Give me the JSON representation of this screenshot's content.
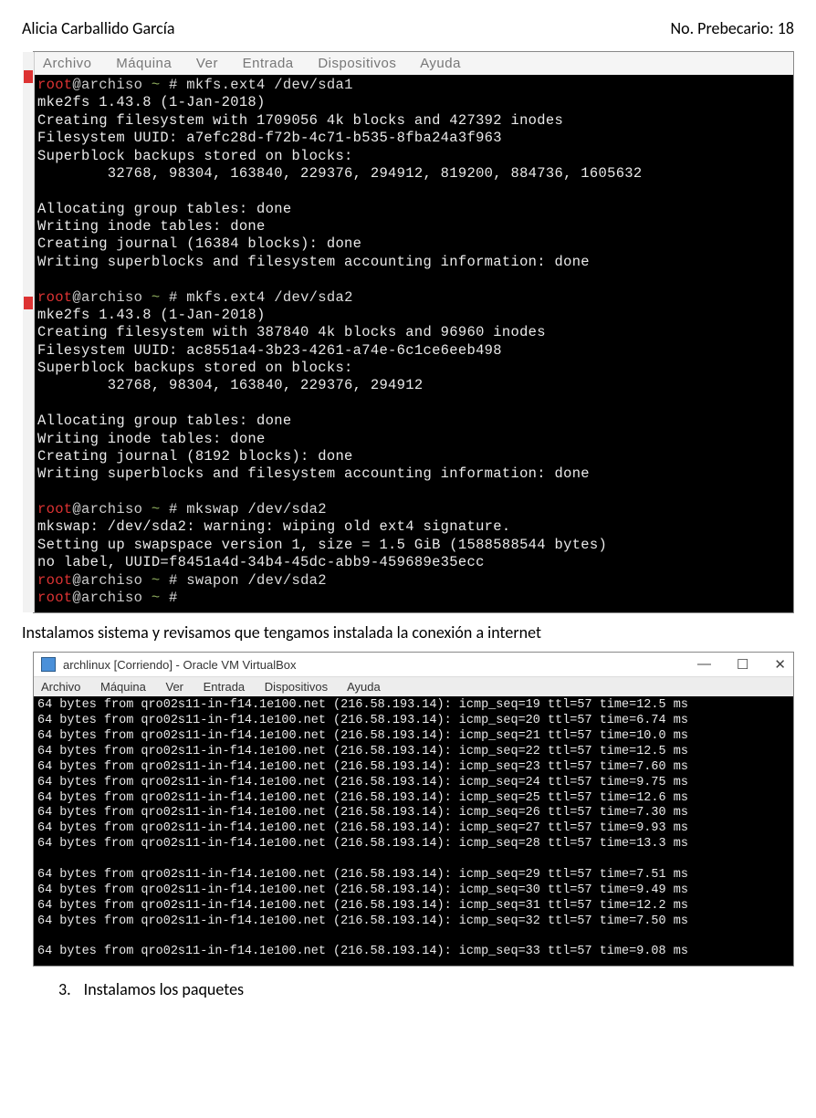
{
  "header": {
    "name": "Alicia Carballido García",
    "right": "No. Prebecario: 18"
  },
  "shot1": {
    "menu": [
      "Archivo",
      "Máquina",
      "Ver",
      "Entrada",
      "Dispositivos",
      "Ayuda"
    ],
    "lines": [
      {
        "type": "prompt",
        "cmd": "mkfs.ext4 /dev/sda1"
      },
      {
        "text": "mke2fs 1.43.8 (1-Jan-2018)"
      },
      {
        "text": "Creating filesystem with 1709056 4k blocks and 427392 inodes"
      },
      {
        "text": "Filesystem UUID: a7efc28d-f72b-4c71-b535-8fba24a3f963"
      },
      {
        "text": "Superblock backups stored on blocks:"
      },
      {
        "text": "        32768, 98304, 163840, 229376, 294912, 819200, 884736, 1605632"
      },
      {
        "text": ""
      },
      {
        "text": "Allocating group tables: done"
      },
      {
        "text": "Writing inode tables: done"
      },
      {
        "text": "Creating journal (16384 blocks): done"
      },
      {
        "text": "Writing superblocks and filesystem accounting information: done"
      },
      {
        "text": ""
      },
      {
        "type": "prompt",
        "cmd": "mkfs.ext4 /dev/sda2"
      },
      {
        "text": "mke2fs 1.43.8 (1-Jan-2018)"
      },
      {
        "text": "Creating filesystem with 387840 4k blocks and 96960 inodes"
      },
      {
        "text": "Filesystem UUID: ac8551a4-3b23-4261-a74e-6c1ce6eeb498"
      },
      {
        "text": "Superblock backups stored on blocks:"
      },
      {
        "text": "        32768, 98304, 163840, 229376, 294912"
      },
      {
        "text": ""
      },
      {
        "text": "Allocating group tables: done"
      },
      {
        "text": "Writing inode tables: done"
      },
      {
        "text": "Creating journal (8192 blocks): done"
      },
      {
        "text": "Writing superblocks and filesystem accounting information: done"
      },
      {
        "text": ""
      },
      {
        "type": "prompt",
        "cmd": "mkswap /dev/sda2"
      },
      {
        "text": "mkswap: /dev/sda2: warning: wiping old ext4 signature."
      },
      {
        "text": "Setting up swapspace version 1, size = 1.5 GiB (1588588544 bytes)"
      },
      {
        "text": "no label, UUID=f8451a4d-34b4-45dc-abb9-459689e35ecc"
      },
      {
        "type": "prompt",
        "cmd": "swapon /dev/sda2"
      },
      {
        "type": "prompt",
        "cmd": ""
      }
    ]
  },
  "caption1": "Instalamos sistema y revisamos que tengamos instalada la conexión a internet",
  "shot2": {
    "title": "archlinux [Corriendo] - Oracle VM VirtualBox",
    "menu": [
      "Archivo",
      "Máquina",
      "Ver",
      "Entrada",
      "Dispositivos",
      "Ayuda"
    ],
    "pings": [
      {
        "seq": 19,
        "time": "12.5"
      },
      {
        "seq": 20,
        "time": "6.74"
      },
      {
        "seq": 21,
        "time": "10.0"
      },
      {
        "seq": 22,
        "time": "12.5"
      },
      {
        "seq": 23,
        "time": "7.60"
      },
      {
        "seq": 24,
        "time": "9.75"
      },
      {
        "seq": 25,
        "time": "12.6"
      },
      {
        "seq": 26,
        "time": "7.30"
      },
      {
        "seq": 27,
        "time": "9.93"
      },
      {
        "seq": 28,
        "time": "13.3"
      }
    ],
    "pings2": [
      {
        "seq": 29,
        "time": "7.51"
      },
      {
        "seq": 30,
        "time": "9.49"
      },
      {
        "seq": 31,
        "time": "12.2"
      },
      {
        "seq": 32,
        "time": "7.50"
      }
    ],
    "pings3": [
      {
        "seq": 33,
        "time": "9.08"
      }
    ],
    "host": "qro02s11-in-f14.1e100.net",
    "ip": "216.58.193.14",
    "bytes": "64",
    "ttl": "57"
  },
  "list3": {
    "num": "3.",
    "text": "Instalamos los paquetes"
  }
}
